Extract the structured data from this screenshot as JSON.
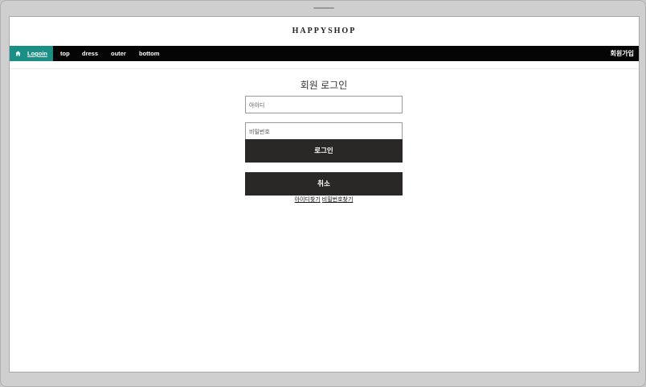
{
  "brand": {
    "name": "HAPPYSHOP"
  },
  "nav": {
    "login_label": "Logoin",
    "items": [
      {
        "label": "top"
      },
      {
        "label": "dress"
      },
      {
        "label": "outer"
      },
      {
        "label": "bottom"
      }
    ],
    "signup_label": "회원가입",
    "home_icon": "home-icon",
    "colors": {
      "bar": "#050505",
      "active": "#1a8f86"
    }
  },
  "login": {
    "title": "회원 로그인",
    "id_placeholder": "아이디",
    "id_value": "",
    "password_placeholder": "비밀번호",
    "password_value": "",
    "submit_label": "로그인",
    "cancel_label": "취소",
    "find_id_label": "아이디찾기",
    "find_password_label": "비밀번호찾기",
    "button_color": "#2a2727"
  }
}
